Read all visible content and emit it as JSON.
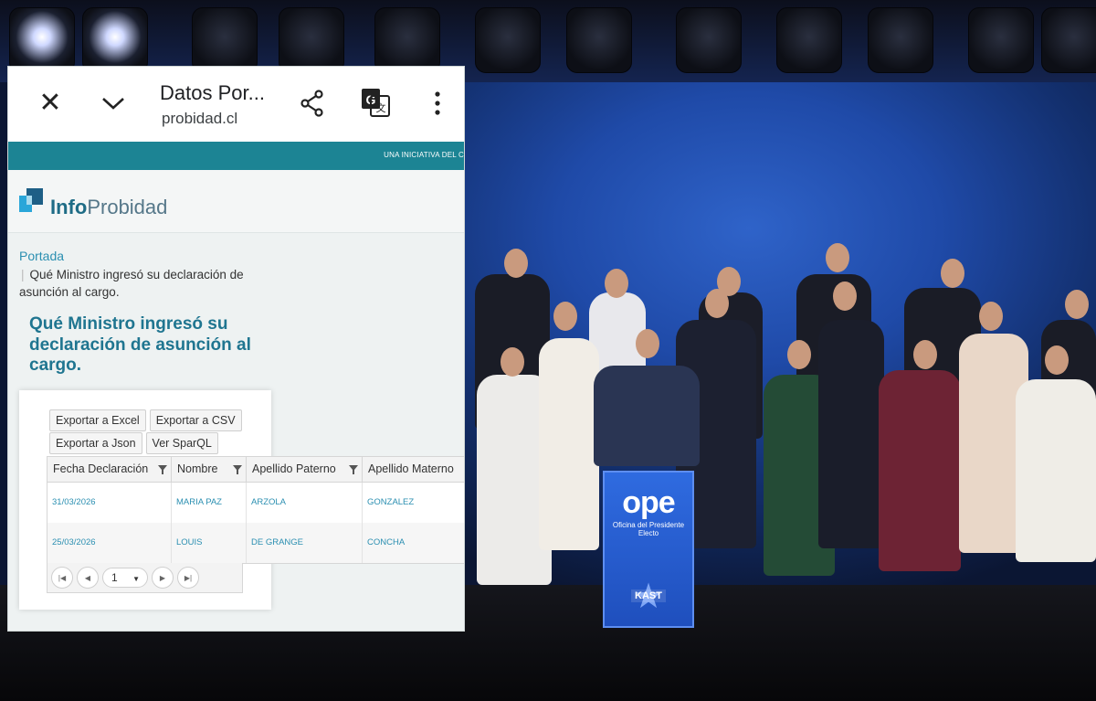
{
  "browser": {
    "title": "Datos Por...",
    "url": "probidad.cl"
  },
  "site": {
    "tagline": "UNA INICIATIVA DEL C",
    "logo_part1": "Info",
    "logo_part2": "Probidad"
  },
  "breadcrumb": {
    "home": "Portada",
    "current": "Qué Ministro ingresó su declaración de asunción al cargo."
  },
  "page": {
    "title": "Qué Ministro ingresó su declaración de asunción al cargo."
  },
  "toolbar": {
    "excel": "Exportar a Excel",
    "csv": "Exportar a CSV",
    "json": "Exportar a Json",
    "sparql": "Ver SparQL"
  },
  "table": {
    "headers": [
      "Fecha Declaración",
      "Nombre",
      "Apellido Paterno",
      "Apellido Materno"
    ],
    "rows": [
      [
        "31/03/2026",
        "MARIA PAZ",
        "ARZOLA",
        "GONZALEZ"
      ],
      [
        "25/03/2026",
        "LOUIS",
        "DE GRANGE",
        "CONCHA"
      ]
    ]
  },
  "pager": {
    "page": "1"
  },
  "podium": {
    "logo": "ope",
    "subtitle": "Oficina del Presidente Electo",
    "badge": "KAST"
  }
}
